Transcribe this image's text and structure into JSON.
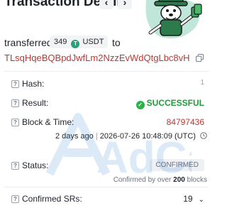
{
  "header": {
    "title": "Transaction Details",
    "prev_label": "‹",
    "next_label": "›"
  },
  "mascot": {
    "icon": "mascot-character"
  },
  "summary": {
    "verb": "transferred",
    "amount": "349",
    "token": "USDT",
    "token_icon_glyph": "T",
    "preposition": "to",
    "address": "TLsqHqeBQBpdJwfLm2NzzEvWdQtgLbc8vH"
  },
  "fields": {
    "hash": {
      "help": "?",
      "label": "Hash:",
      "value": "1"
    },
    "result": {
      "help": "?",
      "label": "Result:",
      "value": "SUCCESSFUL",
      "check_glyph": "✓"
    },
    "block_time": {
      "help": "?",
      "label": "Block & Time:",
      "block": "84797436",
      "relative": "2 days ago",
      "separator": "|",
      "timestamp": "2026-07-26 10:48:09 (UTC)"
    },
    "status": {
      "help": "?",
      "label": "Status:",
      "value": "CONFIRMED",
      "note_prefix": "Confirmed by over",
      "note_count": "200",
      "note_suffix": "blocks"
    },
    "confirmed_srs": {
      "help": "?",
      "label": "Confirmed SRs:",
      "value": "19",
      "chevron": "⌄"
    }
  },
  "watermark": {
    "text": "AdCard"
  },
  "colors": {
    "accent_red": "#c23631",
    "success_green": "#209b3a",
    "usdt_green": "#26a17b"
  }
}
